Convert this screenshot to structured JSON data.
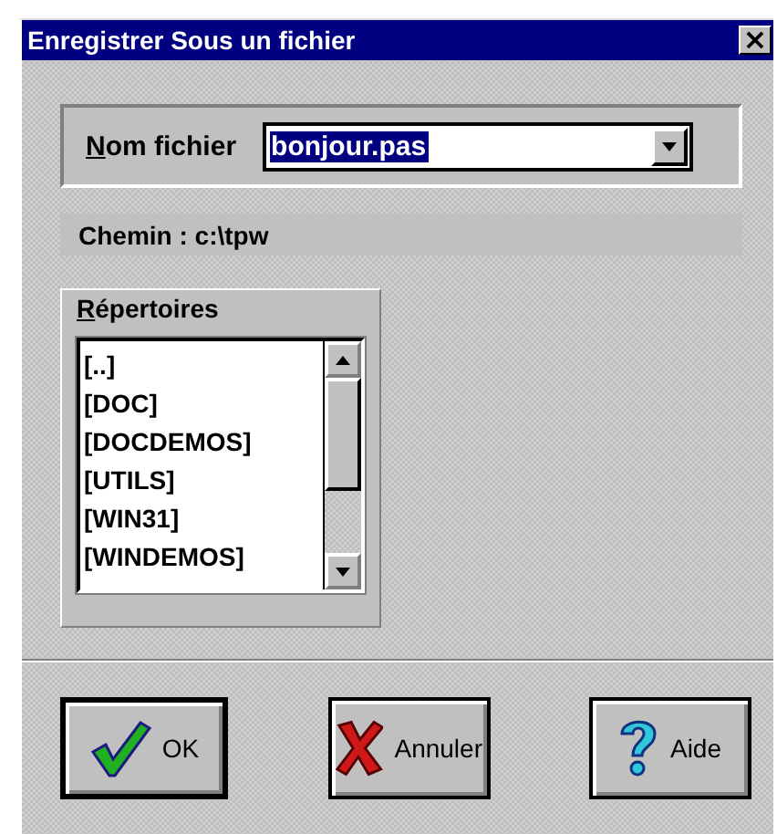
{
  "window": {
    "title": "Enregistrer Sous un fichier",
    "close": "×"
  },
  "filename": {
    "label": "Nom fichier",
    "value": "bonjour.pas",
    "selected": true
  },
  "path": "Chemin : c:\\tpw",
  "directories": {
    "label": "Répertoires",
    "items": [
      {
        "name": "[..]",
        "selected": false
      },
      {
        "name": "[DOC]",
        "selected": false
      },
      {
        "name": "[DOCDEMOS]",
        "selected": false
      },
      {
        "name": "[UTILS]",
        "selected": false
      },
      {
        "name": "[WIN31]",
        "selected": false
      },
      {
        "name": "[WINDEMOS]",
        "selected": false
      }
    ]
  },
  "buttons": [
    {
      "kind": "ok",
      "label": "OK",
      "default": true
    },
    {
      "kind": "cancel",
      "label": "Annuler",
      "default": false
    },
    {
      "kind": "help",
      "label": "Aide",
      "default": false
    }
  ]
}
